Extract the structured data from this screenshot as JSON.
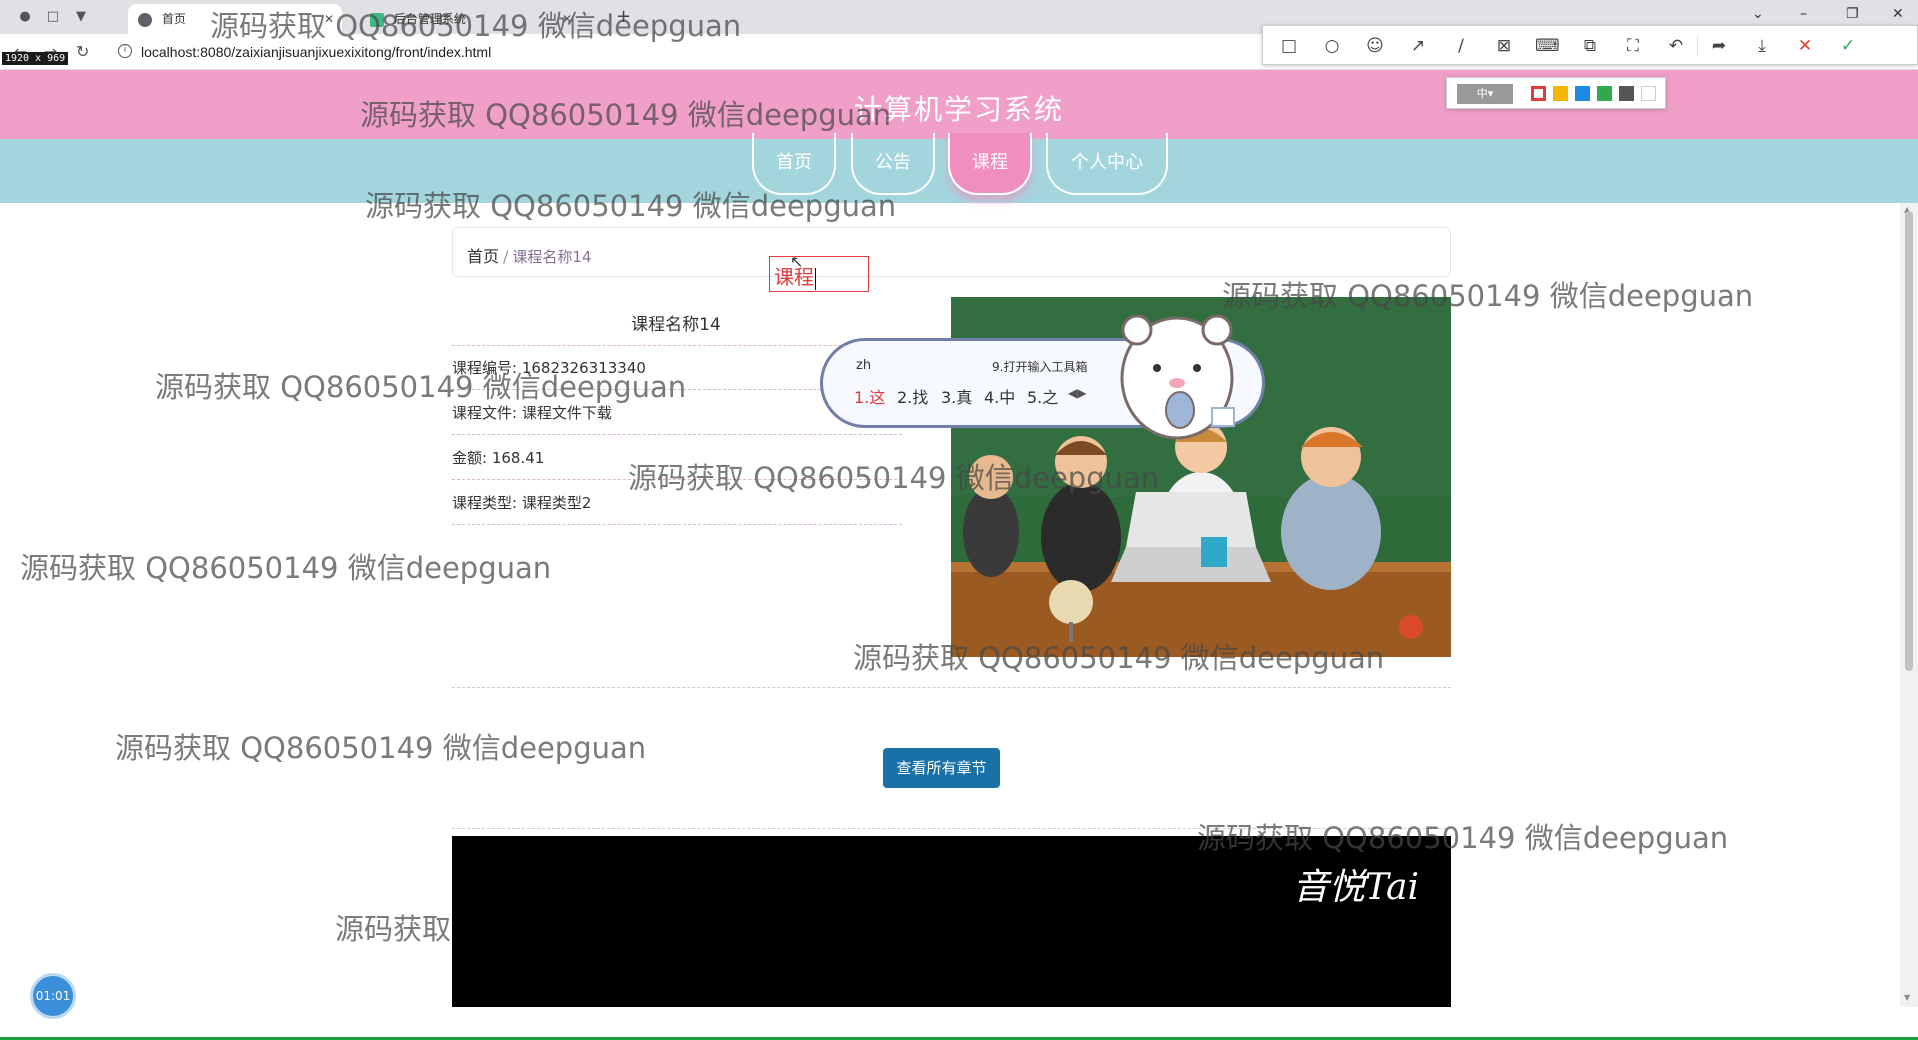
{
  "browser": {
    "tabs": [
      {
        "label": "首页",
        "active": true
      },
      {
        "label": "后台管理系统",
        "active": false
      }
    ],
    "new_tab": "+",
    "url": "localhost:8080/zaixianjisuanjixuexixitong/front/index.html",
    "dims_badge": "1920 x 969"
  },
  "screenshot_tool": {
    "size_select": "中▾",
    "colors": [
      "#e23b3b",
      "#f4b400",
      "#1e88e5",
      "#2fa84f",
      "#555555",
      "#ffffff"
    ]
  },
  "site": {
    "title": "计算机学习系统",
    "nav": [
      {
        "label": "首页",
        "active": false
      },
      {
        "label": "公告",
        "active": false
      },
      {
        "label": "课程",
        "active": true
      },
      {
        "label": "个人中心",
        "active": false
      }
    ],
    "accent_pink": "#f0a0c8",
    "accent_teal": "#a3d5dd"
  },
  "breadcrumb": {
    "home": "首页",
    "separator": "/",
    "current": "课程名称14"
  },
  "course": {
    "name": "课程名称14",
    "rows": [
      {
        "label": "课程编号:",
        "value": "1682326313340"
      },
      {
        "label": "课程文件:",
        "value": "课程文件下载"
      },
      {
        "label": "金额:",
        "value": "168.41"
      },
      {
        "label": "课程类型:",
        "value": "课程类型2"
      }
    ],
    "chapters_button": "查看所有章节",
    "video_watermark": "音悦Tai"
  },
  "annotation": {
    "text": "课程"
  },
  "ime": {
    "pinyin": "zh",
    "toolbox": "9.打开输入工具箱",
    "candidates": [
      "1.这",
      "2.找",
      "3.真",
      "4.中",
      "5.之"
    ]
  },
  "timer": "01:01",
  "watermark_text": "源码获取 QQ86050149 微信deepguan",
  "watermark_partial": "源码获取"
}
